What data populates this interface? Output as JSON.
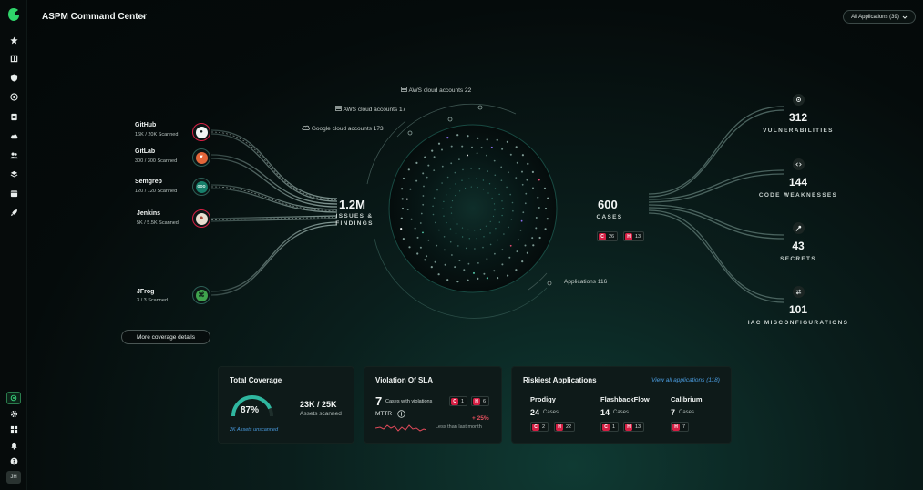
{
  "header": {
    "title": "ASPM Command Center",
    "app_filter": "All Applications (39)"
  },
  "sidebar": {
    "icons": [
      "star-icon",
      "book-icon",
      "shield-icon",
      "target-icon",
      "document-icon",
      "cloud-icon",
      "users-icon",
      "layers-icon",
      "calendar-icon",
      "rocket-icon"
    ],
    "bottom_icons": [
      "sparkle-icon",
      "gear-icon",
      "grid-icon",
      "bell-icon",
      "help-icon"
    ],
    "avatar": "JH"
  },
  "sources": [
    {
      "name": "GitHub",
      "scanned": "16K / 20K Scanned",
      "icon": "github-icon"
    },
    {
      "name": "GitLab",
      "scanned": "300 / 300 Scanned",
      "icon": "gitlab-icon"
    },
    {
      "name": "Semgrep",
      "scanned": "120 / 120 Scanned",
      "icon": "semgrep-icon"
    },
    {
      "name": "Jenkins",
      "scanned": "5K / 5.5K Scanned",
      "icon": "jenkins-icon"
    },
    {
      "name": "JFrog",
      "scanned": "3 / 3 Scanned",
      "icon": "jfrog-icon"
    }
  ],
  "more_coverage": "More coverage details",
  "issues": {
    "value": "1.2M",
    "label_line1": "ISSUES &",
    "label_line2": "FINDINGS"
  },
  "clouds": [
    {
      "label": "AWS cloud accounts",
      "count": "22"
    },
    {
      "label": "AWS cloud accounts",
      "count": "17"
    },
    {
      "label": "Google cloud accounts",
      "count": "173"
    }
  ],
  "applications": {
    "label": "Applications",
    "count": "116"
  },
  "cases": {
    "value": "600",
    "label": "CASES",
    "critical_letter": "C",
    "critical": "26",
    "high_letter": "H",
    "high": "13"
  },
  "categories": [
    {
      "value": "312",
      "label": "VULNERABILITIES",
      "icon": "bug-icon"
    },
    {
      "value": "144",
      "label": "CODE WEAKNESSES",
      "icon": "code-icon"
    },
    {
      "value": "43",
      "label": "SECRETS",
      "icon": "key-icon"
    },
    {
      "value": "101",
      "label": "IAC MISCONFIGURATIONS",
      "icon": "transfer-icon"
    }
  ],
  "coverage_card": {
    "title": "Total Coverage",
    "percent_text": "87%",
    "percent": 0.87,
    "assets": "23K / 25K",
    "assets_label": "Assets scanned",
    "unscanned": "2K Assets unscanned"
  },
  "sla_card": {
    "title": "Violation Of SLA",
    "count": "7",
    "count_label": "Cases with violations",
    "critical_letter": "C",
    "critical": "1",
    "high_letter": "H",
    "high": "6",
    "mttr_label": "MTTR",
    "change": "+ 25%",
    "change_label": "Less than last month"
  },
  "risky_card": {
    "title": "Riskiest Applications",
    "view_all": "View all applications (118)",
    "apps": [
      {
        "name": "Prodigy",
        "cases": "24",
        "cases_label": "Cases",
        "c": "2",
        "h": "22"
      },
      {
        "name": "FlashbackFlow",
        "cases": "14",
        "cases_label": "Cases",
        "c": "1",
        "h": "13"
      },
      {
        "name": "Calibrium",
        "cases": "7",
        "cases_label": "Cases",
        "h": "7"
      }
    ],
    "c_letter": "C",
    "h_letter": "H"
  },
  "colors": {
    "accent": "#2fb7a0",
    "critical": "#d61f44",
    "link": "#4a9ce0"
  }
}
